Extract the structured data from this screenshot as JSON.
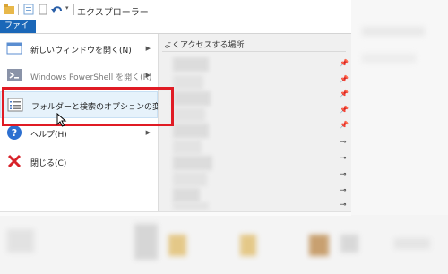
{
  "window": {
    "title": "エクスプローラー"
  },
  "ribbon": {
    "file_tab": "ファイル"
  },
  "menu": {
    "items": [
      {
        "label": "新しいウィンドウを開く(N)",
        "icon": "window-icon",
        "has_submenu": true
      },
      {
        "label": "Windows PowerShell を開く(R)",
        "icon": "powershell-icon",
        "has_submenu": true
      },
      {
        "label": "フォルダーと検索のオプションの変更(O)",
        "icon": "folder-options-icon",
        "has_submenu": false
      },
      {
        "label": "ヘルプ(H)",
        "icon": "help-icon",
        "has_submenu": true
      },
      {
        "label": "閉じる(C)",
        "icon": "close-icon",
        "has_submenu": false
      }
    ]
  },
  "recent": {
    "header": "よくアクセスする場所"
  },
  "colors": {
    "accent": "#1a67b8",
    "highlight_box": "#e01b24"
  }
}
